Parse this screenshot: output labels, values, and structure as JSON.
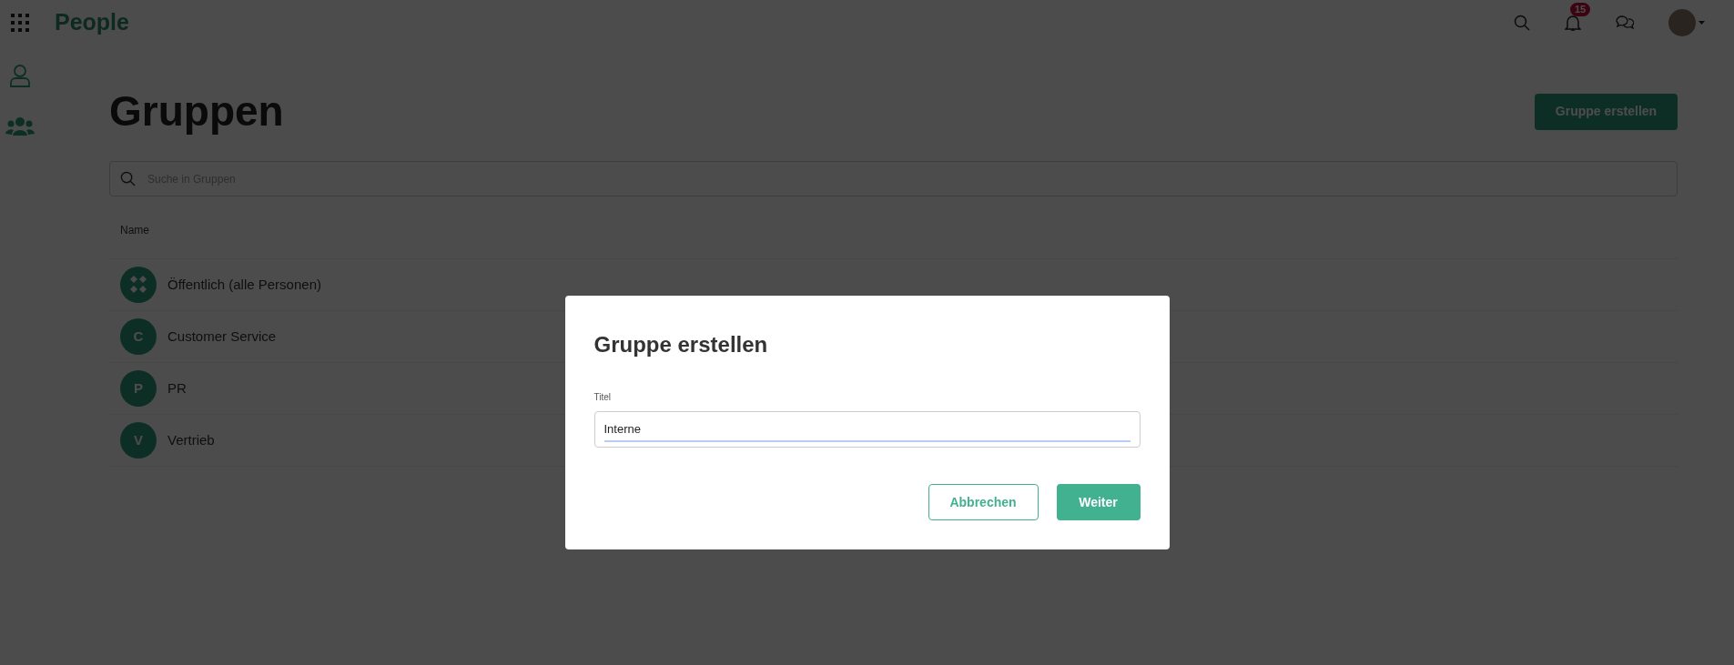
{
  "app": {
    "title": "People"
  },
  "header": {
    "notification_count": "15"
  },
  "sidebar": {
    "items": [
      {
        "kind": "person"
      },
      {
        "kind": "group"
      }
    ]
  },
  "page": {
    "title": "Gruppen",
    "create_button": "Gruppe erstellen",
    "search": {
      "placeholder": "Suche in Gruppen"
    }
  },
  "table": {
    "columns": [
      "Name"
    ],
    "rows": [
      {
        "kind": "public",
        "initial": "",
        "name": "Öffentlich (alle Personen)"
      },
      {
        "kind": "letter",
        "initial": "C",
        "name": "Customer Service"
      },
      {
        "kind": "letter",
        "initial": "P",
        "name": "PR"
      },
      {
        "kind": "letter",
        "initial": "V",
        "name": "Vertrieb"
      }
    ]
  },
  "dialog": {
    "title": "Gruppe erstellen",
    "field_label": "Titel",
    "field_value": "Interne",
    "buttons": [
      {
        "kind": "secondary",
        "label": "Abbrechen"
      },
      {
        "kind": "primary",
        "label": "Weiter"
      }
    ]
  }
}
